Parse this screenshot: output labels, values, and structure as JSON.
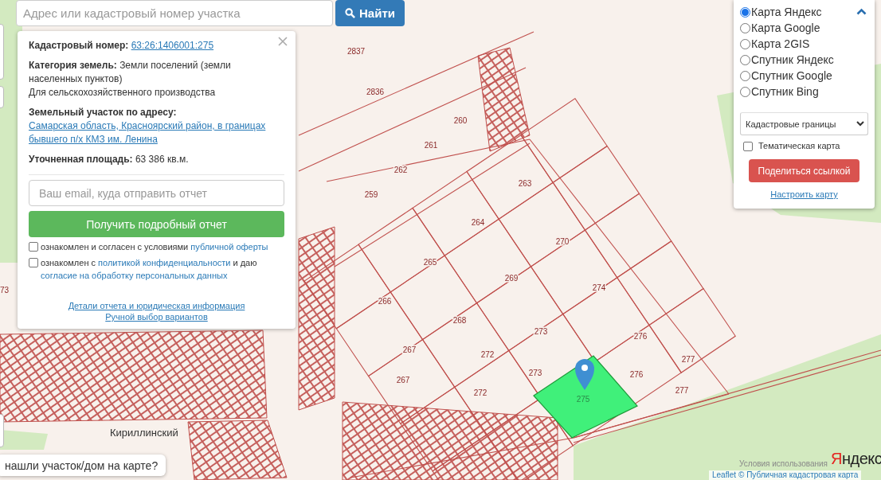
{
  "search": {
    "placeholder": "Адрес или кадастровый номер участка",
    "button": "Найти"
  },
  "info_popup": {
    "fields": [
      {
        "label": "Кадастровый номер:",
        "value": "63:26:1406001:275",
        "kind": "link"
      },
      {
        "label": "Категория земель:",
        "value": "Земли поселений (земли населенных пунктов)",
        "note": "Для сельскохозяйственного производства",
        "kind": "text"
      },
      {
        "label": "Земельный участок по адресу:",
        "value": "Самарская область, Красноярский район, в границах бывшего п/х КМЗ им. Ленина",
        "kind": "address"
      },
      {
        "label": "Уточненная площадь:",
        "value": "63 386 кв.м.",
        "kind": "text"
      }
    ],
    "email_placeholder": "Ваш email, куда отправить отчет",
    "submit": "Получить подробный отчет",
    "consents": [
      {
        "checked": false,
        "parts": [
          {
            "text": "ознакомлен и согласен с условиями ",
            "kind": "text"
          },
          {
            "text": "публичной оферты",
            "kind": "link"
          }
        ]
      },
      {
        "checked": false,
        "parts": [
          {
            "text": "ознакомлен с ",
            "kind": "text"
          },
          {
            "text": "политикой конфиденциальности",
            "kind": "link"
          },
          {
            "text": " и даю ",
            "kind": "text"
          },
          {
            "text": "согласие на обработку персональных данных",
            "kind": "link"
          }
        ]
      }
    ],
    "links": [
      "Детали отчета и юридическая информация",
      "Ручной выбор вариантов"
    ]
  },
  "layers": {
    "expanded": true,
    "options": [
      {
        "label": "Карта Яндекс",
        "selected": true
      },
      {
        "label": "Карта Google",
        "selected": false
      },
      {
        "label": "Карта 2GIS",
        "selected": false
      },
      {
        "label": "Спутник Яндекс",
        "selected": false
      },
      {
        "label": "Спутник Google",
        "selected": false
      },
      {
        "label": "Спутник Bing",
        "selected": false
      }
    ],
    "overlay_select": "Кадастровые границы",
    "thematic": {
      "label": "Тематическая карта",
      "checked": false
    },
    "share": "Поделиться ссылкой",
    "configure": "Настроить карту"
  },
  "map": {
    "parcels": [
      {
        "text": "2837",
        "selected": false
      },
      {
        "text": "2836",
        "selected": false
      },
      {
        "text": "260",
        "selected": false
      },
      {
        "text": "261",
        "selected": false
      },
      {
        "text": "262",
        "selected": false
      },
      {
        "text": "259",
        "selected": false
      },
      {
        "text": "263",
        "selected": false
      },
      {
        "text": "264",
        "selected": false
      },
      {
        "text": "270",
        "selected": false
      },
      {
        "text": "265",
        "selected": false
      },
      {
        "text": "269",
        "selected": false
      },
      {
        "text": "274",
        "selected": false
      },
      {
        "text": "266",
        "selected": false
      },
      {
        "text": "268",
        "selected": false
      },
      {
        "text": "273",
        "selected": false
      },
      {
        "text": "276",
        "selected": false
      },
      {
        "text": "267",
        "selected": false
      },
      {
        "text": "272",
        "selected": false
      },
      {
        "text": "273",
        "selected": false
      },
      {
        "text": "276",
        "selected": false
      },
      {
        "text": "277",
        "selected": false
      },
      {
        "text": "267",
        "selected": false
      },
      {
        "text": "272",
        "selected": false
      },
      {
        "text": "275",
        "selected": true
      },
      {
        "text": "277",
        "selected": false
      }
    ],
    "edge_label": "73",
    "place_label": "Кириллинский"
  },
  "prompt": "нашли участок/дом на карте?",
  "provider_logo": "Яндекс",
  "terms": "Условия использования",
  "attribution": {
    "leaflet": "Leaflet",
    "source": "© Публичная кадастровая карта"
  }
}
